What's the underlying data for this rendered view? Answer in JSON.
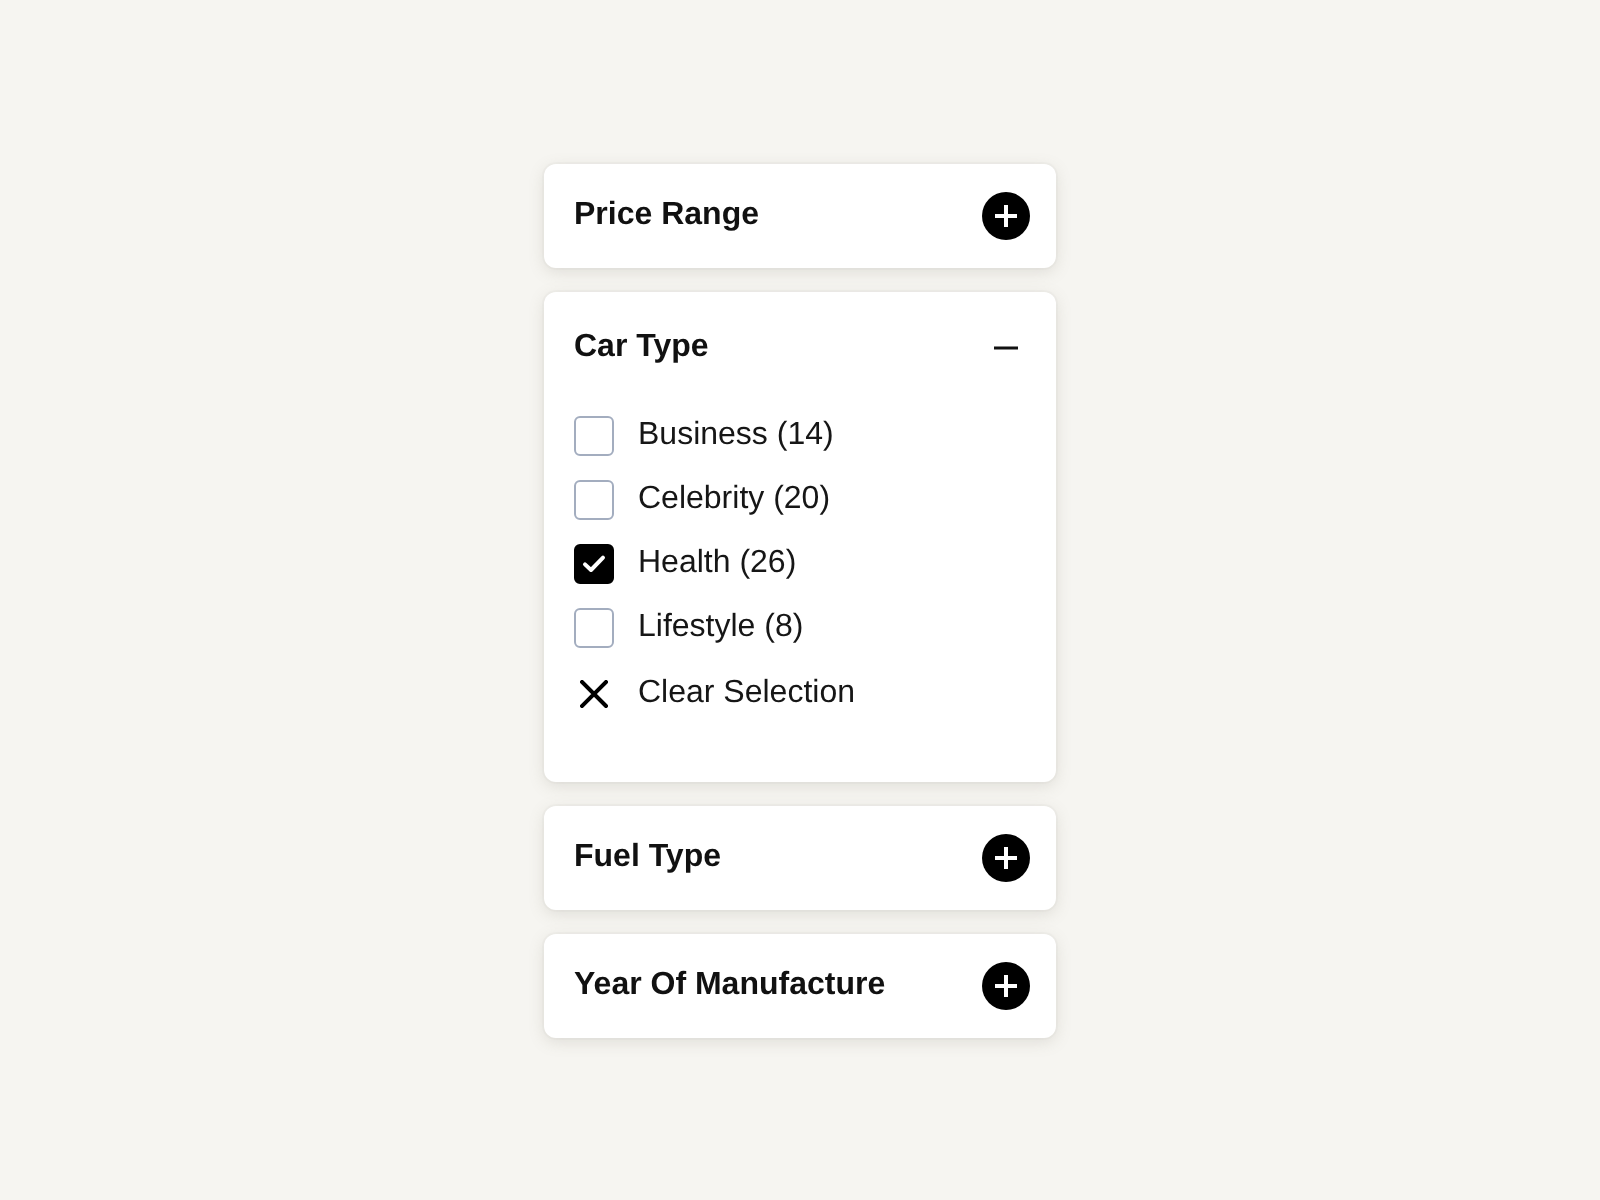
{
  "filters": [
    {
      "title": "Price Range",
      "expanded": false
    },
    {
      "title": "Car Type",
      "expanded": true,
      "options": [
        {
          "label": "Business (14)",
          "checked": false
        },
        {
          "label": "Celebrity (20)",
          "checked": false
        },
        {
          "label": "Health (26)",
          "checked": true
        },
        {
          "label": "Lifestyle (8)",
          "checked": false
        }
      ],
      "clear_label": "Clear Selection"
    },
    {
      "title": "Fuel Type",
      "expanded": false
    },
    {
      "title": "Year Of Manufacture",
      "expanded": false
    }
  ]
}
